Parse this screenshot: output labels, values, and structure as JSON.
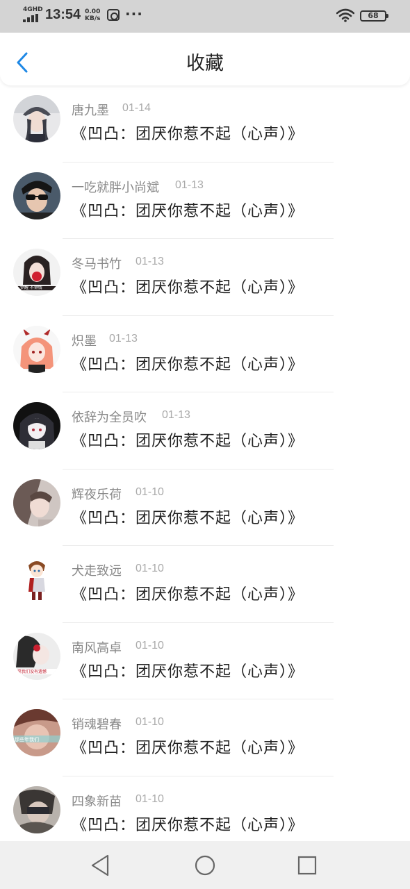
{
  "status_bar": {
    "network": "4GHD",
    "time": "13:54",
    "speed_value": "0.00",
    "speed_unit": "KB/s",
    "battery": "68"
  },
  "header": {
    "title": "收藏"
  },
  "favorites": [
    {
      "author": "唐九墨",
      "date": "01-14",
      "book": "《凹凸：团厌你惹不起（心声）》"
    },
    {
      "author": "一吃就胖小尚斌",
      "date": "01-13",
      "book": "《凹凸：团厌你惹不起（心声）》"
    },
    {
      "author": "冬马书竹",
      "date": "01-13",
      "book": "《凹凸：团厌你惹不起（心声）》"
    },
    {
      "author": "炽墨",
      "date": "01-13",
      "book": "《凹凸：团厌你惹不起（心声）》"
    },
    {
      "author": "依辞为全员吹",
      "date": "01-13",
      "book": "《凹凸：团厌你惹不起（心声）》"
    },
    {
      "author": "辉夜乐荷",
      "date": "01-10",
      "book": "《凹凸：团厌你惹不起（心声）》"
    },
    {
      "author": "犬走致远",
      "date": "01-10",
      "book": "《凹凸：团厌你惹不起（心声）》"
    },
    {
      "author": "南风高卓",
      "date": "01-10",
      "book": "《凹凸：团厌你惹不起（心声）》"
    },
    {
      "author": "销魂碧春",
      "date": "01-10",
      "book": "《凹凸：团厌你惹不起（心声）》"
    },
    {
      "author": "四象新苗",
      "date": "01-10",
      "book": "《凹凸：团厌你惹不起（心声）》"
    }
  ],
  "colors": {
    "accent": "#1e88e5",
    "status_bar_bg": "#d4d4d4",
    "nav_bar_bg": "#f0f0f0"
  }
}
